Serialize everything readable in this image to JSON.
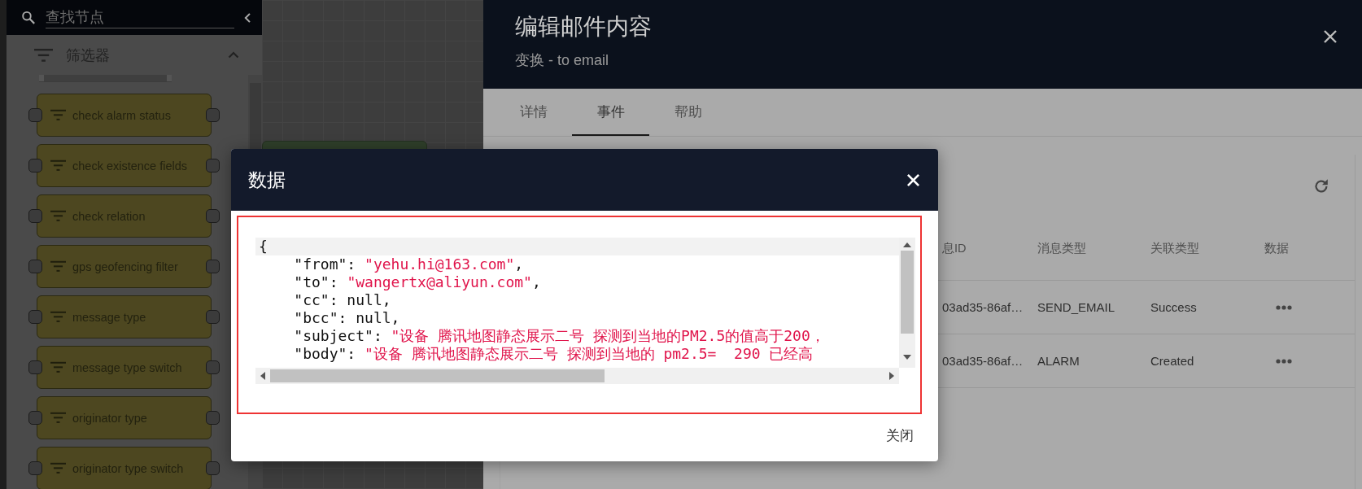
{
  "sidebar": {
    "search": {
      "placeholder": "查找节点"
    },
    "section": {
      "title": "筛选器",
      "expanded": true
    },
    "nodes": [
      {
        "label": "check alarm status"
      },
      {
        "label": "check existence fields"
      },
      {
        "label": "check relation"
      },
      {
        "label": "gps geofencing filter"
      },
      {
        "label": "message type"
      },
      {
        "label": "message type switch"
      },
      {
        "label": "originator type"
      },
      {
        "label": "originator type switch"
      }
    ]
  },
  "panel": {
    "title": "编辑邮件内容",
    "subtitle": "变换 - to email",
    "tabs": [
      {
        "label": "详情",
        "selected": false
      },
      {
        "label": "事件",
        "selected": true
      },
      {
        "label": "帮助",
        "selected": false
      }
    ],
    "table": {
      "columns": [
        "息ID",
        "消息类型",
        "关联类型",
        "数据"
      ],
      "rows": [
        {
          "cells": [
            "03ad35-86af…",
            "SEND_EMAIL",
            "Success"
          ]
        },
        {
          "cells": [
            "03ad35-86af…",
            "ALARM",
            "Created"
          ]
        }
      ]
    }
  },
  "dialog": {
    "title": "数据",
    "code_lines": [
      [
        {
          "text": "{",
          "kind": "plain"
        }
      ],
      [
        {
          "text": "    \"from\": ",
          "kind": "plain"
        },
        {
          "text": "\"yehu.hi@163.com\"",
          "kind": "string"
        },
        {
          "text": ",",
          "kind": "plain"
        }
      ],
      [
        {
          "text": "    \"to\": ",
          "kind": "plain"
        },
        {
          "text": "\"wangertx@aliyun.com\"",
          "kind": "string"
        },
        {
          "text": ",",
          "kind": "plain"
        }
      ],
      [
        {
          "text": "    \"cc\": null,",
          "kind": "plain"
        }
      ],
      [
        {
          "text": "    \"bcc\": null,",
          "kind": "plain"
        }
      ],
      [
        {
          "text": "    \"subject\": ",
          "kind": "plain"
        },
        {
          "text": "\"设备 腾讯地图静态展示二号 探测到当地的PM2.5的值高于200，",
          "kind": "string"
        }
      ],
      [
        {
          "text": "    \"body\": ",
          "kind": "plain"
        },
        {
          "text": "\"设备 腾讯地图静态展示二号 探测到当地的 pm2.5=  290 已经高",
          "kind": "string"
        }
      ]
    ],
    "buttons": [
      "关闭"
    ]
  }
}
